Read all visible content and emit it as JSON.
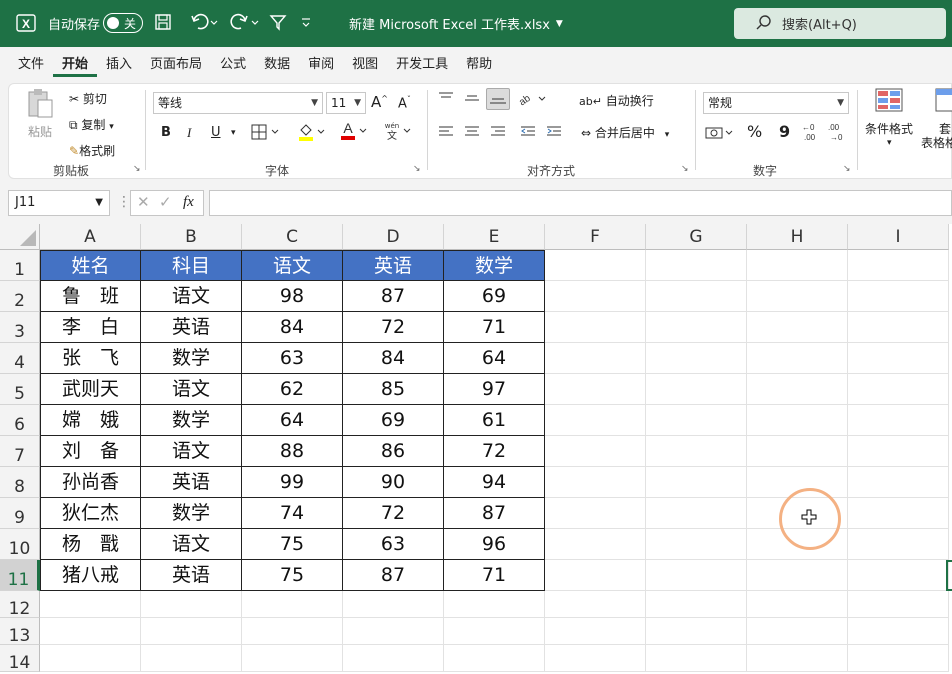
{
  "titlebar": {
    "autosave_label": "自动保存",
    "autosave_state": "关",
    "filename": "新建 Microsoft Excel 工作表.xlsx",
    "search_placeholder": "搜索(Alt+Q)"
  },
  "menu": [
    "文件",
    "开始",
    "插入",
    "页面布局",
    "公式",
    "数据",
    "审阅",
    "视图",
    "开发工具",
    "帮助"
  ],
  "menu_active": "开始",
  "ribbon": {
    "clipboard": {
      "paste": "粘贴",
      "cut": "剪切",
      "copy": "复制",
      "format_painter": "格式刷",
      "group": "剪贴板"
    },
    "font": {
      "name": "等线",
      "size": "11",
      "bold": "B",
      "italic": "I",
      "underline": "U",
      "group": "字体"
    },
    "alignment": {
      "wrap": "自动换行",
      "merge": "合并后居中",
      "group": "对齐方式"
    },
    "number": {
      "format": "常规",
      "percent": "%",
      "comma": "9",
      "group": "数字"
    },
    "styles": {
      "conditional": "条件格式",
      "table_fmt": "套",
      "table_fmt2": "表格格"
    }
  },
  "formula_bar": {
    "cell_ref": "J11",
    "fx": "fx",
    "content": ""
  },
  "sheet": {
    "columns": [
      "A",
      "B",
      "C",
      "D",
      "E",
      "F",
      "G",
      "H",
      "I"
    ],
    "rows": [
      "1",
      "2",
      "3",
      "4",
      "5",
      "6",
      "7",
      "8",
      "9",
      "10",
      "11",
      "12",
      "13",
      "14"
    ],
    "headers": [
      "姓名",
      "科目",
      "语文",
      "英语",
      "数学"
    ],
    "data": [
      [
        "鲁　班",
        "语文",
        "98",
        "87",
        "69"
      ],
      [
        "李　白",
        "英语",
        "84",
        "72",
        "71"
      ],
      [
        "张　飞",
        "数学",
        "63",
        "84",
        "64"
      ],
      [
        "武则天",
        "语文",
        "62",
        "85",
        "97"
      ],
      [
        "嫦　娥",
        "数学",
        "64",
        "69",
        "61"
      ],
      [
        "刘　备",
        "语文",
        "88",
        "86",
        "72"
      ],
      [
        "孙尚香",
        "英语",
        "99",
        "90",
        "94"
      ],
      [
        "狄仁杰",
        "数学",
        "74",
        "72",
        "87"
      ],
      [
        "杨　戬",
        "语文",
        "75",
        "63",
        "96"
      ],
      [
        "猪八戒",
        "英语",
        "75",
        "87",
        "71"
      ]
    ]
  },
  "colors": {
    "brand": "#1e7145",
    "header_fill": "#4472c4",
    "cursor_ring": "#f4b183"
  }
}
